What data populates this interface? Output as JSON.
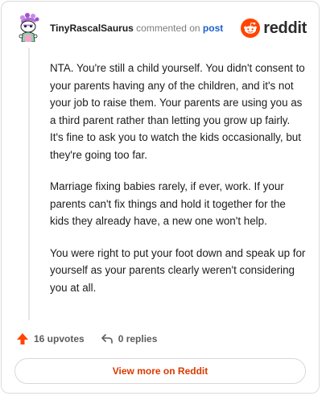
{
  "header": {
    "username": "TinyRascalSaurus",
    "action_text": "commented on",
    "link_text": "post",
    "brand": "reddit"
  },
  "comment": {
    "paragraphs": [
      "NTA. You're still a child yourself. You didn't consent to your parents having any of the children, and it's not your job to raise them. Your parents are using you as a third parent rather than letting you grow up fairly. It's fine to ask you to watch the kids occasionally, but they're going too far.",
      "Marriage fixing babies rarely, if ever, work. If your parents can't fix things and hold it together for the kids they already have, a new one won't help.",
      "You were right to put your foot down and speak up for yourself as your parents clearly weren't considering you at all."
    ]
  },
  "actions": {
    "upvotes_label": "16 upvotes",
    "replies_label": "0 replies"
  },
  "footer": {
    "view_more_label": "View more on Reddit"
  },
  "colors": {
    "brand_orange": "#ff4500",
    "link_blue": "#1a5fd0",
    "view_more_text": "#d93a00"
  },
  "icons": {
    "avatar": "snoo-avatar-icon",
    "brand": "reddit-snoo-icon",
    "upvote": "upvote-arrow-icon",
    "reply": "reply-arrow-icon"
  }
}
